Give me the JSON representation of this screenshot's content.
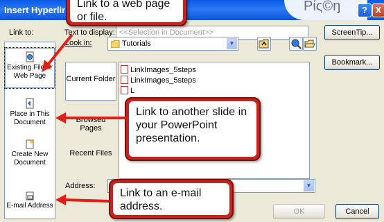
{
  "window": {
    "title": "Insert Hyperlink",
    "help_label": "?",
    "close_label": "X"
  },
  "header": {
    "link_to_label": "Link to:",
    "text_to_display_label": "Text to display:",
    "text_to_display_value": "<<Selection in Document>>",
    "screentip_label": "ScreenTip..."
  },
  "link_bar": {
    "items": [
      {
        "label": "Existing File or Web Page",
        "selected": true,
        "icon": "globe-document-icon"
      },
      {
        "label": "Place in This Document",
        "selected": false,
        "icon": "document-place-icon"
      },
      {
        "label": "Create New Document",
        "selected": false,
        "icon": "new-document-icon"
      },
      {
        "label": "E-mail Address",
        "selected": false,
        "icon": "email-icon"
      }
    ]
  },
  "browse": {
    "look_in_label": "Look in:",
    "look_in_value": "Tutorials",
    "current_folder_label": "Current Folder",
    "browsed_pages_label": "Browsed Pages",
    "recent_files_label": "Recent Files",
    "files": [
      "LinkImages_5steps",
      "LinkImages_5steps",
      "L"
    ],
    "bookmark_label": "Bookmark..."
  },
  "address": {
    "label": "Address:",
    "value": ""
  },
  "footer": {
    "ok_label": "OK",
    "cancel_label": "Cancel"
  },
  "callouts": {
    "web": "Link to a web page or file.",
    "slide": "Link to another slide in your PowerPoint presentation.",
    "email": "Link to an e-mail address."
  },
  "decor": {
    "top_right_text": "Ρίς©ŋ"
  },
  "colors": {
    "callout_red": "#c8241d",
    "arrow_red": "#e02018",
    "titlebar_blue": "#0a5ae6"
  }
}
